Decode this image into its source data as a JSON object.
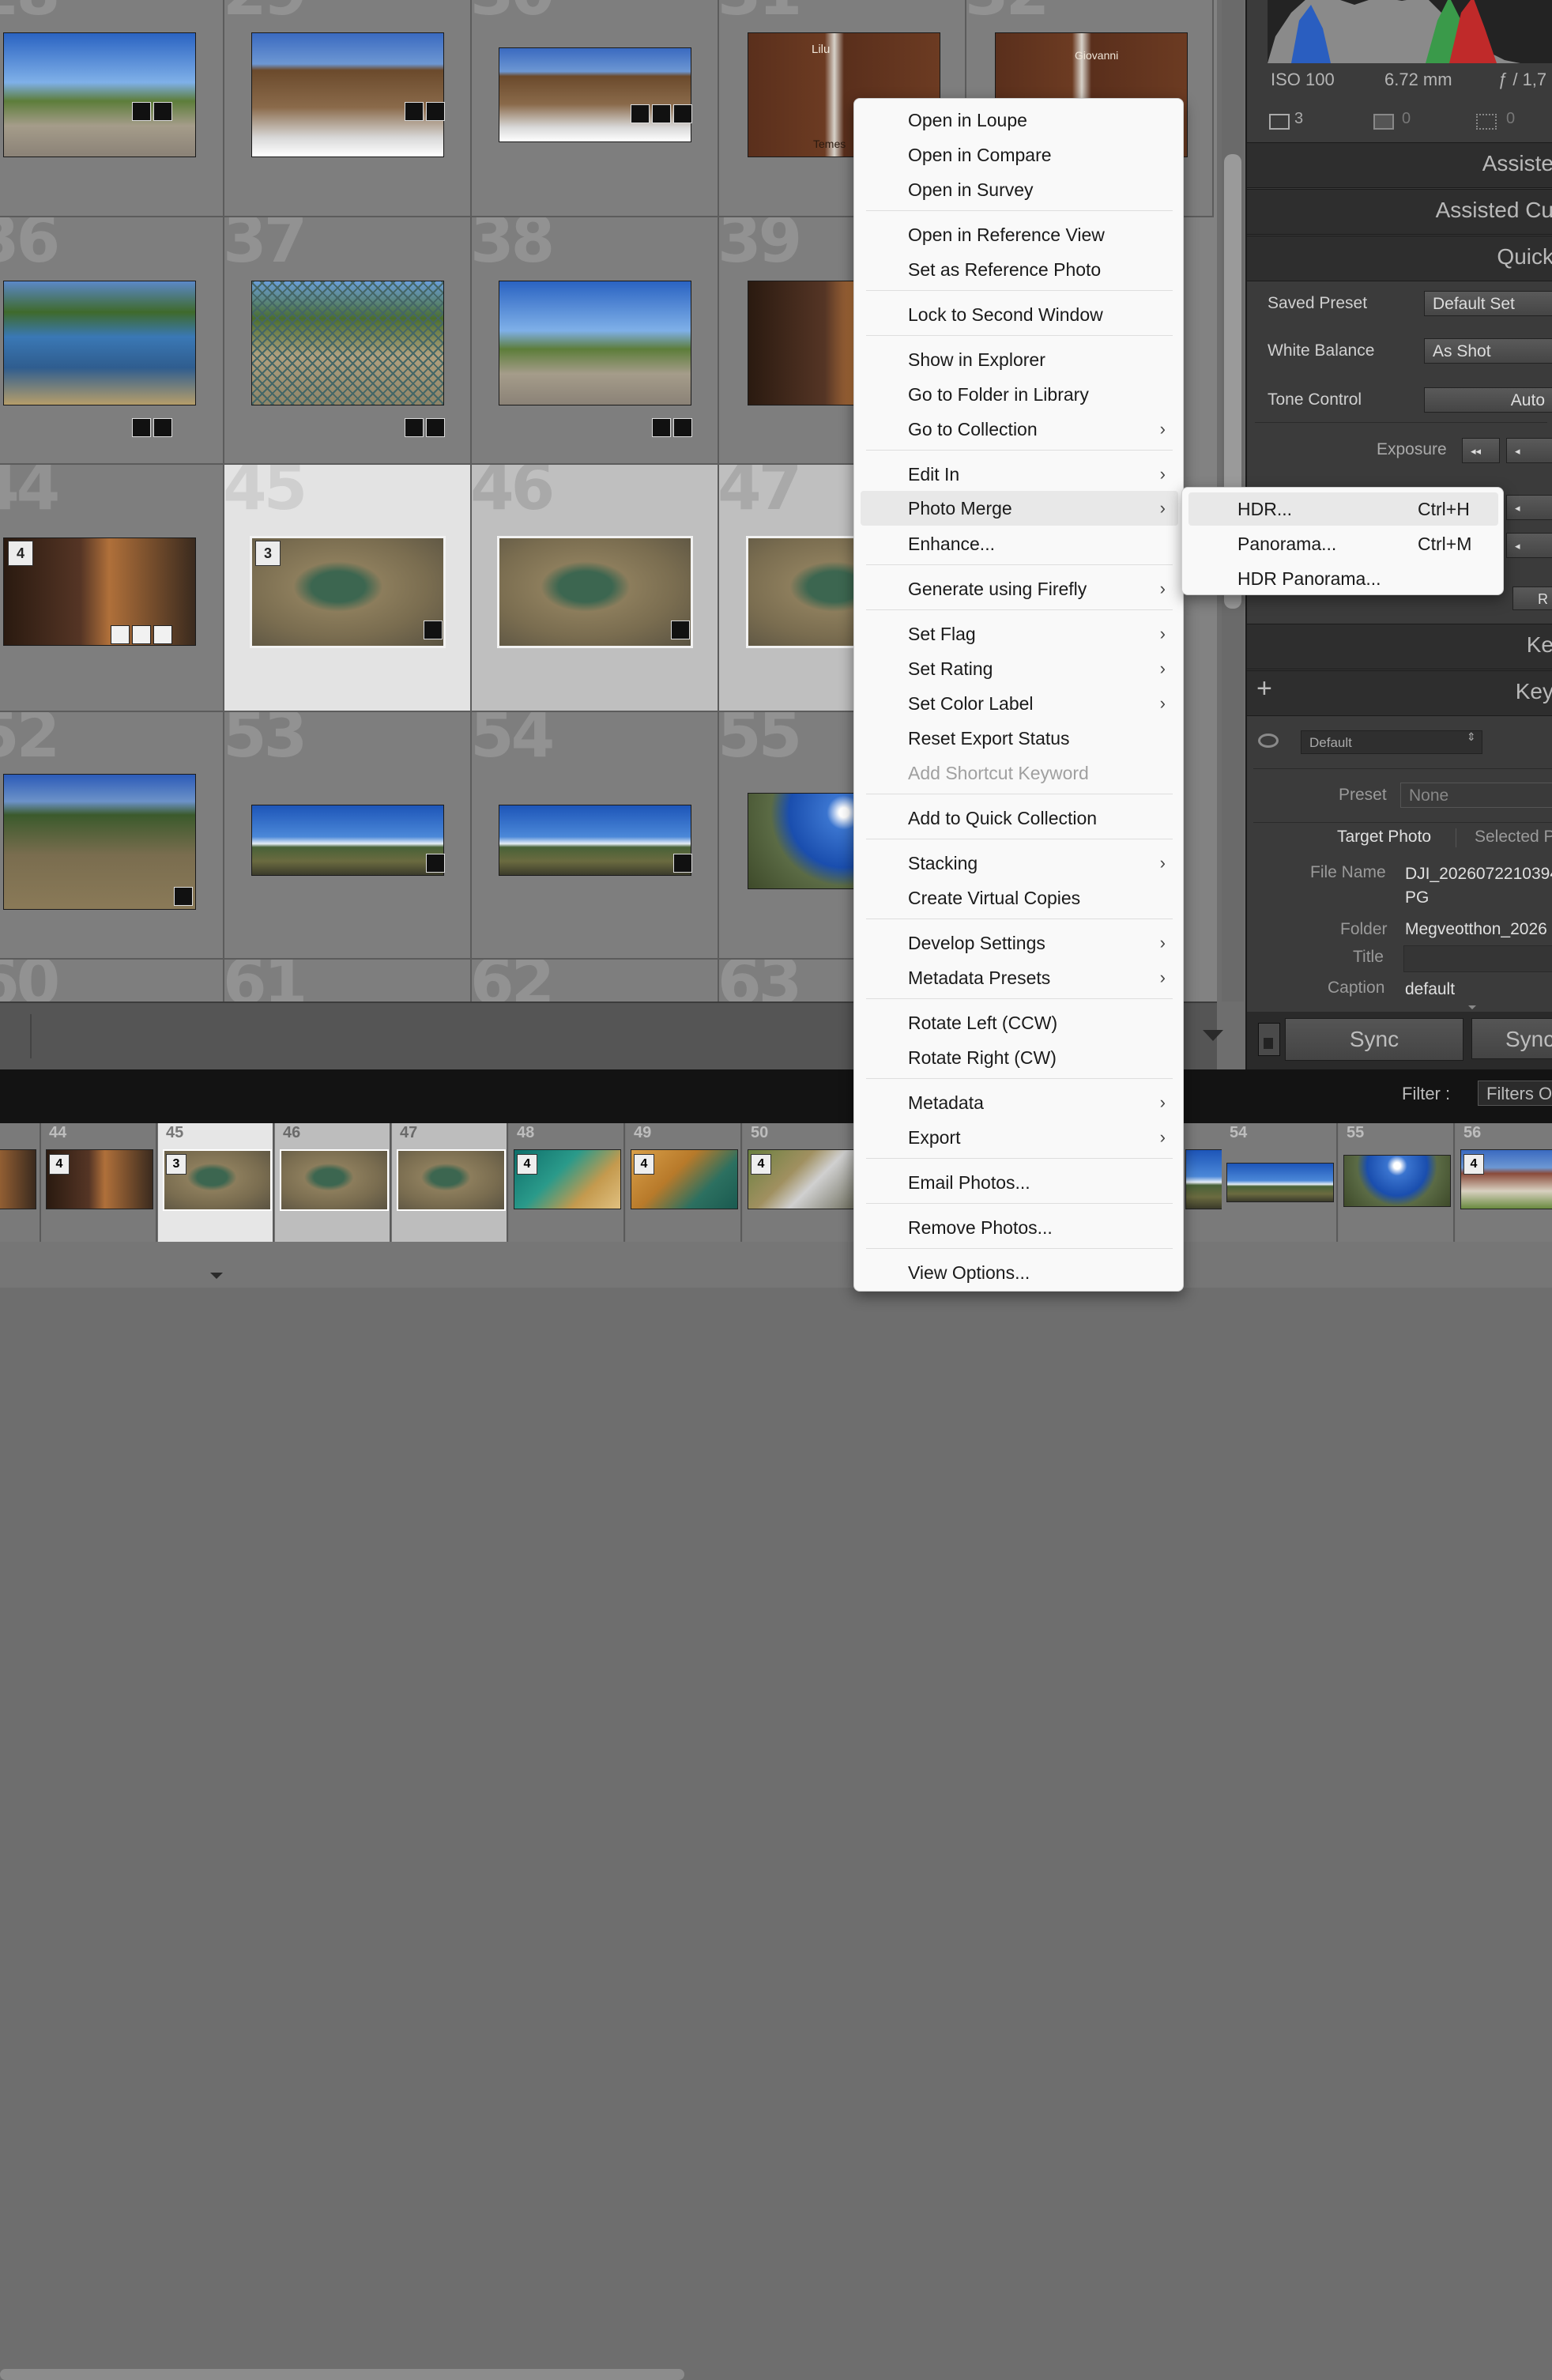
{
  "grid": {
    "row1_numbers": [
      "28",
      "29",
      "30",
      "31",
      "32"
    ],
    "row2_numbers": [
      "36",
      "37",
      "38",
      "39"
    ],
    "row3_numbers": [
      "44",
      "45",
      "46",
      "47"
    ],
    "row4_numbers": [
      "52",
      "53",
      "54",
      "55"
    ],
    "row5_numbers": [
      "60",
      "61",
      "62",
      "63"
    ],
    "stack_badges": {
      "c44": "4",
      "c45": "3"
    },
    "thumb_text_31": "Lilu",
    "thumb_text_31b": "Temes",
    "thumb_text_32": "Giovanni"
  },
  "filmstrip": {
    "numbers": [
      "44",
      "45",
      "46",
      "47",
      "48",
      "49",
      "50",
      "54",
      "55",
      "56"
    ],
    "badges": [
      "4",
      "3",
      "4",
      "4",
      "4",
      "4"
    ]
  },
  "right_panel": {
    "histogram_info": {
      "iso": "ISO 100",
      "focal": "6.72 mm",
      "aperture": "ƒ / 1,7"
    },
    "counts": {
      "a": "3",
      "b": "0",
      "c": "0"
    },
    "headers": [
      "Assiste",
      "Assisted Cu",
      "Quick",
      "Ke",
      "Key"
    ],
    "saved_preset_label": "Saved Preset",
    "saved_preset_value": "Default Set",
    "white_balance_label": "White Balance",
    "white_balance_value": "As Shot",
    "tone_control_label": "Tone Control",
    "tone_control_value": "Auto",
    "exposure_label": "Exposure",
    "exposure_btn1": "◂◂",
    "exposure_btn2": "◂",
    "right_small_btn": "R",
    "plus": "+",
    "default_select": "Default",
    "preset_label": "Preset",
    "preset_value": "None",
    "target_photo": "Target Photo",
    "selected_tab": "Selected P",
    "file_name_label": "File Name",
    "file_name_value": "DJI_2026072210394",
    "file_name_value2": "PG",
    "folder_label": "Folder",
    "folder_value": "Megveotthon_2026",
    "title_label": "Title",
    "caption_label": "Caption",
    "caption_value": "default",
    "sync_label": "Sync",
    "sync_label2": "Sync"
  },
  "filter": {
    "label": "Filter :",
    "value": "Filters O"
  },
  "context_menu": {
    "items": [
      {
        "label": "Open in Loupe"
      },
      {
        "label": "Open in Compare"
      },
      {
        "label": "Open in Survey"
      },
      {
        "label": "Open in Reference View"
      },
      {
        "label": "Set as Reference Photo"
      },
      {
        "label": "Lock to Second Window"
      },
      {
        "label": "Show in Explorer"
      },
      {
        "label": "Go to Folder in Library"
      },
      {
        "label": "Go to Collection",
        "submenu": true
      },
      {
        "label": "Edit In",
        "submenu": true
      },
      {
        "label": "Photo Merge",
        "submenu": true,
        "highlighted": true
      },
      {
        "label": "Enhance..."
      },
      {
        "label": "Generate using Firefly",
        "submenu": true
      },
      {
        "label": "Set Flag",
        "submenu": true
      },
      {
        "label": "Set Rating",
        "submenu": true
      },
      {
        "label": "Set Color Label",
        "submenu": true
      },
      {
        "label": "Reset Export Status"
      },
      {
        "label": "Add Shortcut Keyword",
        "disabled": true
      },
      {
        "label": "Add to Quick Collection"
      },
      {
        "label": "Stacking",
        "submenu": true
      },
      {
        "label": "Create Virtual Copies"
      },
      {
        "label": "Develop Settings",
        "submenu": true
      },
      {
        "label": "Metadata Presets",
        "submenu": true
      },
      {
        "label": "Rotate Left (CCW)"
      },
      {
        "label": "Rotate Right (CW)"
      },
      {
        "label": "Metadata",
        "submenu": true
      },
      {
        "label": "Export",
        "submenu": true
      },
      {
        "label": "Email Photos..."
      },
      {
        "label": "Remove Photos..."
      },
      {
        "label": "View Options..."
      }
    ],
    "arrow": "›"
  },
  "submenu": {
    "items": [
      {
        "label": "HDR...",
        "shortcut": "Ctrl+H"
      },
      {
        "label": "Panorama...",
        "shortcut": "Ctrl+M"
      },
      {
        "label": "HDR Panorama...",
        "shortcut": ""
      }
    ]
  }
}
